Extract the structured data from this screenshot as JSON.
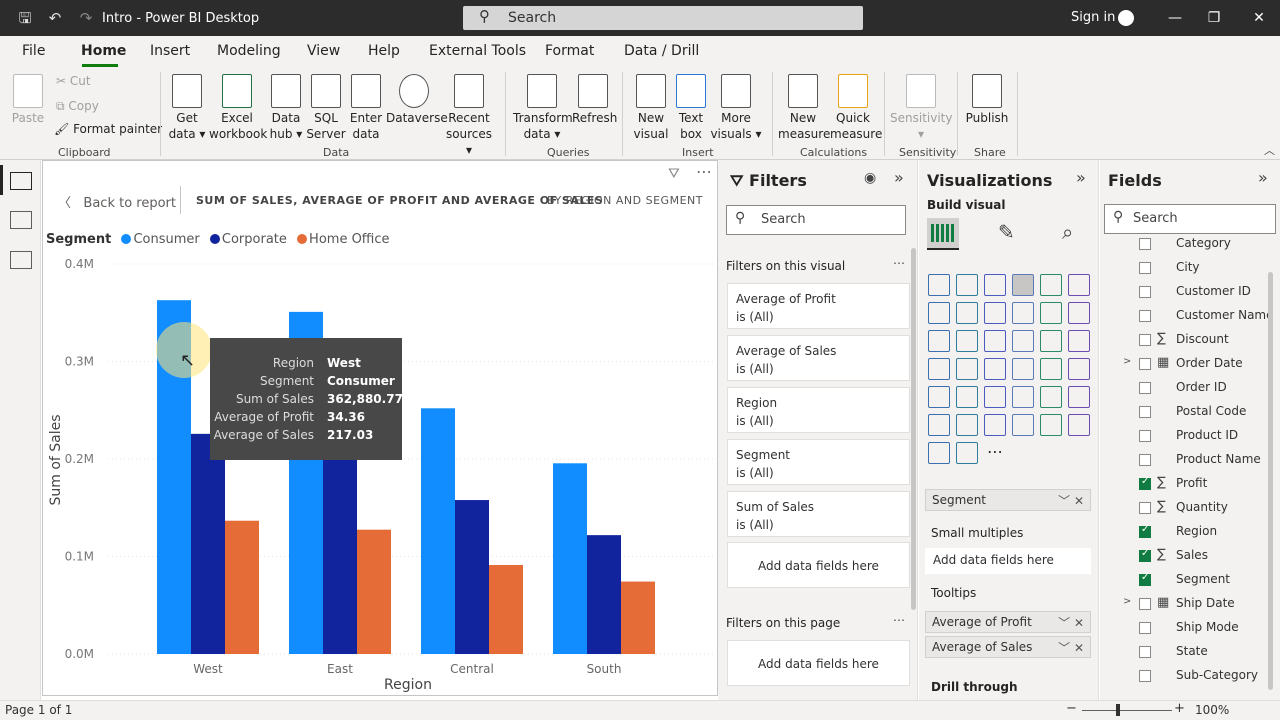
{
  "app_title": "Intro - Power BI Desktop",
  "search_placeholder": "Search",
  "signin_label": "Sign in",
  "menu": [
    "File",
    "Home",
    "Insert",
    "Modeling",
    "View",
    "Help",
    "External Tools",
    "Format",
    "Data / Drill"
  ],
  "ribbon": {
    "clipboard": {
      "paste": "Paste",
      "cut": "Cut",
      "copy": "Copy",
      "format_painter": "Format painter",
      "label": "Clipboard"
    },
    "data": {
      "get_data": [
        "Get",
        "data"
      ],
      "excel": [
        "Excel",
        "workbook"
      ],
      "data_hub": [
        "Data",
        "hub"
      ],
      "sql": [
        "SQL",
        "Server"
      ],
      "enter": [
        "Enter",
        "data"
      ],
      "dataverse": [
        "Dataverse"
      ],
      "recent": [
        "Recent",
        "sources"
      ],
      "label": "Data"
    },
    "queries": {
      "transform": [
        "Transform",
        "data"
      ],
      "refresh": [
        "Refresh"
      ],
      "label": "Queries"
    },
    "insert": {
      "new_visual": [
        "New",
        "visual"
      ],
      "text_box": [
        "Text",
        "box"
      ],
      "more": [
        "More",
        "visuals"
      ],
      "label": "Insert"
    },
    "calculations": {
      "new_measure": [
        "New",
        "measure"
      ],
      "quick_measure": [
        "Quick",
        "measure"
      ],
      "label": "Calculations"
    },
    "sensitivity": {
      "btn": [
        "Sensitivity"
      ],
      "label": "Sensitivity"
    },
    "share": {
      "publish": [
        "Publish"
      ],
      "label": "Share"
    }
  },
  "report": {
    "back_label": "Back to report",
    "title": "SUM OF SALES, AVERAGE OF PROFIT AND AVERAGE OF SALES",
    "subtitle": "BY REGION AND SEGMENT"
  },
  "chart_data": {
    "type": "bar",
    "legend_title": "Segment",
    "categories": [
      "West",
      "East",
      "Central",
      "South"
    ],
    "series": [
      {
        "name": "Consumer",
        "color": "#118dff",
        "values": [
          362880.77,
          350900,
          252000,
          195600
        ]
      },
      {
        "name": "Corporate",
        "color": "#12239e",
        "values": [
          225800,
          200400,
          157900,
          121900
        ]
      },
      {
        "name": "Home Office",
        "color": "#e66c37",
        "values": [
          136700,
          127500,
          91300,
          74300
        ]
      }
    ],
    "ylim": [
      0,
      400000
    ],
    "yticks": [
      "0.0M",
      "0.1M",
      "0.2M",
      "0.3M",
      "0.4M"
    ],
    "xlabel": "Region",
    "ylabel": "Sum of Sales",
    "grid": true
  },
  "tooltip": [
    {
      "k": "Region",
      "v": "West"
    },
    {
      "k": "Segment",
      "v": "Consumer"
    },
    {
      "k": "Sum of Sales",
      "v": "362,880.77"
    },
    {
      "k": "Average of Profit",
      "v": "34.36"
    },
    {
      "k": "Average of Sales",
      "v": "217.03"
    }
  ],
  "filters": {
    "title": "Filters",
    "search": "Search",
    "on_visual_label": "Filters on this visual",
    "cards": [
      {
        "name": "Average of Profit",
        "state": "is (All)"
      },
      {
        "name": "Average of Sales",
        "state": "is (All)"
      },
      {
        "name": "Region",
        "state": "is (All)"
      },
      {
        "name": "Segment",
        "state": "is (All)"
      },
      {
        "name": "Sum of Sales",
        "state": "is (All)"
      }
    ],
    "add_fields": "Add data fields here",
    "on_page_label": "Filters on this page",
    "add_fields_page": "Add data fields here"
  },
  "viz": {
    "title": "Visualizations",
    "build_visual": "Build visual",
    "segment_well": "Segment",
    "small_multiples_label": "Small multiples",
    "small_multiples_add": "Add data fields here",
    "tooltips_label": "Tooltips",
    "tooltip_wells": [
      "Average of Profit",
      "Average of Sales"
    ],
    "drill_through": "Drill through"
  },
  "fields": {
    "title": "Fields",
    "search": "Search",
    "items": [
      {
        "name": "Category",
        "checked": false,
        "sigma": false,
        "expand": false
      },
      {
        "name": "City",
        "checked": false,
        "sigma": false,
        "expand": false
      },
      {
        "name": "Customer ID",
        "checked": false,
        "sigma": false,
        "expand": false
      },
      {
        "name": "Customer Name",
        "checked": false,
        "sigma": false,
        "expand": false
      },
      {
        "name": "Discount",
        "checked": false,
        "sigma": true,
        "expand": false
      },
      {
        "name": "Order Date",
        "checked": false,
        "sigma": false,
        "expand": true,
        "table_icon": true
      },
      {
        "name": "Order ID",
        "checked": false,
        "sigma": false,
        "expand": false
      },
      {
        "name": "Postal Code",
        "checked": false,
        "sigma": false,
        "expand": false
      },
      {
        "name": "Product ID",
        "checked": false,
        "sigma": false,
        "expand": false
      },
      {
        "name": "Product Name",
        "checked": false,
        "sigma": false,
        "expand": false
      },
      {
        "name": "Profit",
        "checked": true,
        "sigma": true,
        "expand": false
      },
      {
        "name": "Quantity",
        "checked": false,
        "sigma": true,
        "expand": false
      },
      {
        "name": "Region",
        "checked": true,
        "sigma": false,
        "expand": false
      },
      {
        "name": "Sales",
        "checked": true,
        "sigma": true,
        "expand": false
      },
      {
        "name": "Segment",
        "checked": true,
        "sigma": false,
        "expand": false
      },
      {
        "name": "Ship Date",
        "checked": false,
        "sigma": false,
        "expand": true,
        "table_icon": true
      },
      {
        "name": "Ship Mode",
        "checked": false,
        "sigma": false,
        "expand": false
      },
      {
        "name": "State",
        "checked": false,
        "sigma": false,
        "expand": false
      },
      {
        "name": "Sub-Category",
        "checked": false,
        "sigma": false,
        "expand": false
      }
    ]
  },
  "status": {
    "page": "Page 1 of 1",
    "zoom": "100%"
  }
}
